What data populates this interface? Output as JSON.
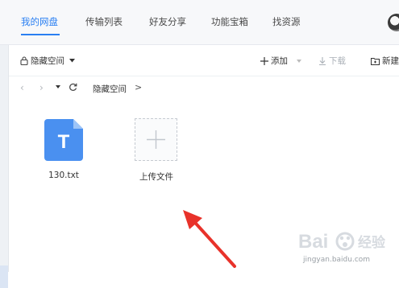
{
  "nav": {
    "tabs": [
      {
        "label": "我的网盘",
        "active": true
      },
      {
        "label": "传输列表",
        "active": false
      },
      {
        "label": "好友分享",
        "active": false
      },
      {
        "label": "功能宝箱",
        "active": false
      },
      {
        "label": "找资源",
        "active": false
      }
    ],
    "accent_color": "#2a7ff2"
  },
  "toolbar": {
    "space_label": "隐藏空间",
    "add_label": "添加",
    "download_label": "下载",
    "new_label": "新建"
  },
  "breadcrumb": {
    "path": "隐藏空间",
    "separator": ">"
  },
  "files": [
    {
      "name": "130.txt",
      "icon": "txt-file-icon",
      "glyph": "T",
      "color": "#4a90f0"
    }
  ],
  "upload": {
    "label": "上传文件",
    "icon": "plus-icon"
  },
  "watermark": {
    "brand": "Bai",
    "brand_suffix": "经验",
    "url": "jingyan.baidu.com"
  }
}
